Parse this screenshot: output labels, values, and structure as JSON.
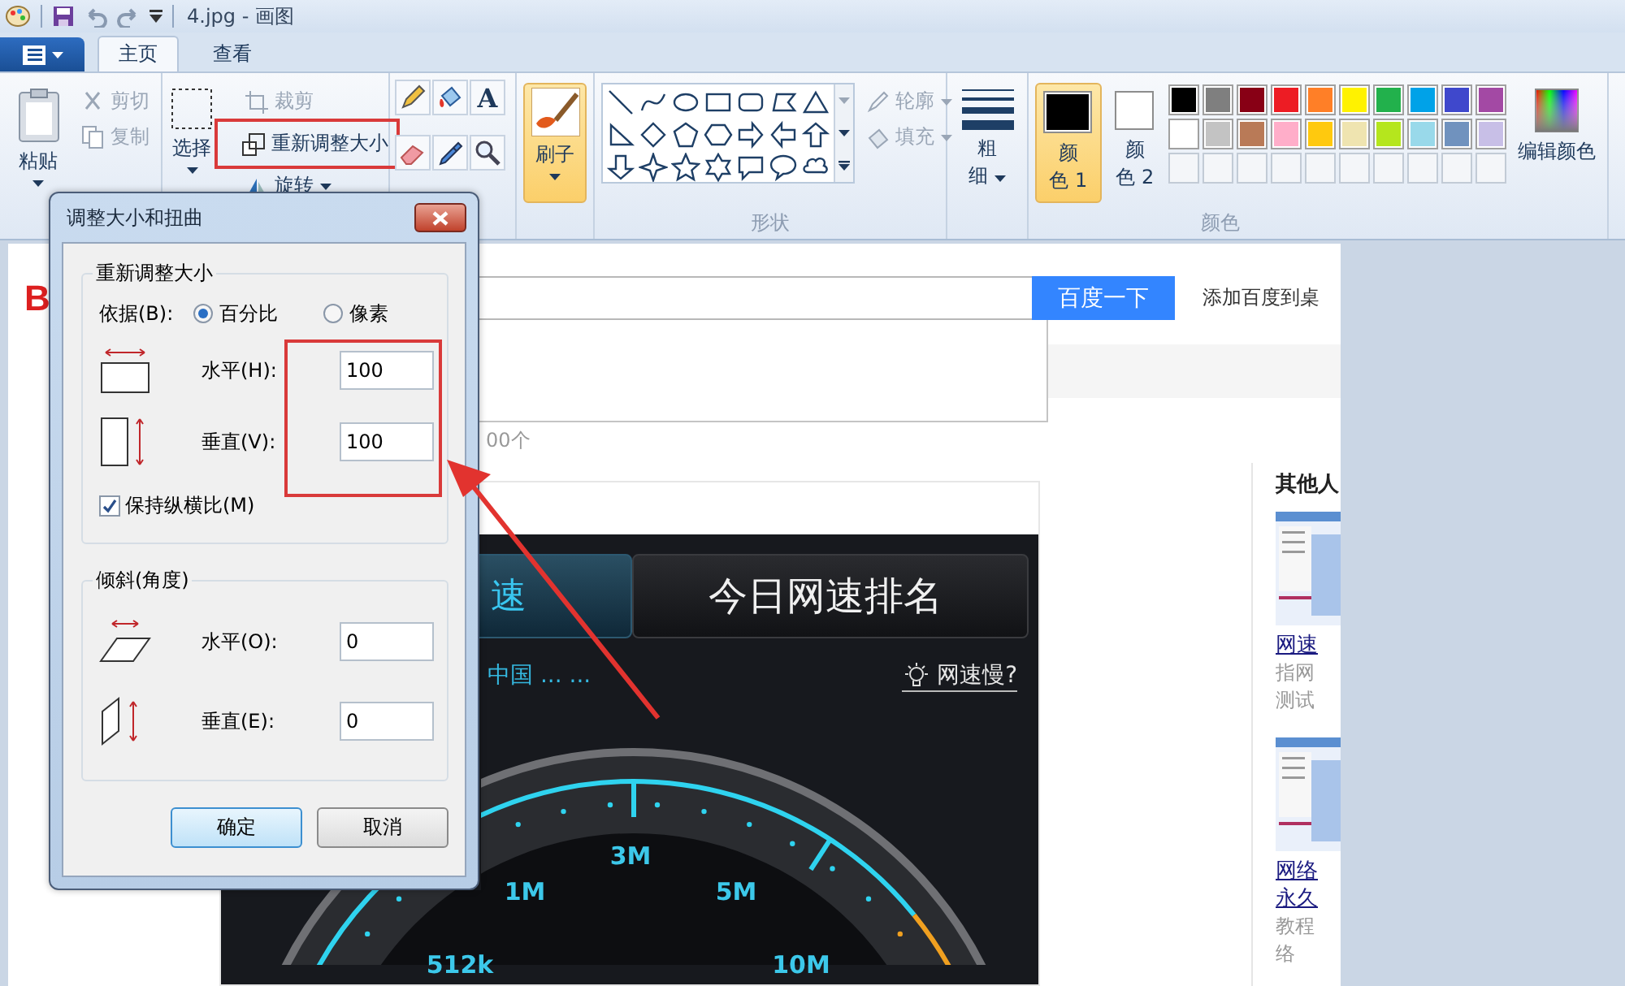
{
  "window": {
    "title": "4.jpg - 画图"
  },
  "tabs": [
    {
      "label": "主页",
      "selected": true
    },
    {
      "label": "查看",
      "selected": false
    }
  ],
  "ribbon": {
    "clipboard": {
      "paste": "粘贴",
      "cut": {
        "label": "剪切",
        "disabled": true
      },
      "copy": {
        "label": "复制",
        "disabled": true
      }
    },
    "image": {
      "select": "选择",
      "crop": {
        "label": "裁剪",
        "disabled": true
      },
      "resize": {
        "label": "重新调整大小",
        "disabled": false
      },
      "rotate": {
        "label": "旋转",
        "disabled": false
      }
    },
    "tools": {
      "text_tool": "A"
    },
    "brushes": {
      "label": "刷子",
      "selected": true
    },
    "shapes": {
      "label": "形状",
      "outline": {
        "label": "轮廓",
        "disabled": true
      },
      "fill": {
        "label": "填充",
        "disabled": true
      }
    },
    "size": {
      "label_lines": [
        "粗",
        "细"
      ]
    },
    "colors": {
      "label": "颜色",
      "edit": "编辑颜色",
      "color1": {
        "label_lines": [
          "颜",
          "色 1"
        ],
        "color": "#000000",
        "selected": true
      },
      "color2": {
        "label_lines": [
          "颜",
          "色 2"
        ],
        "color": "#ffffff",
        "selected": false
      },
      "palette": [
        {
          "color": "#000000"
        },
        {
          "color": "#7f7f7f"
        },
        {
          "color": "#880015"
        },
        {
          "color": "#ed1c24"
        },
        {
          "color": "#ff7f27"
        },
        {
          "color": "#fff200"
        },
        {
          "color": "#22b14c"
        },
        {
          "color": "#00a2e8"
        },
        {
          "color": "#3f48cc"
        },
        {
          "color": "#a349a4"
        },
        {
          "color": "#ffffff"
        },
        {
          "color": "#c3c3c3"
        },
        {
          "color": "#b97a57"
        },
        {
          "color": "#ffaec9"
        },
        {
          "color": "#ffc90e"
        },
        {
          "color": "#efe4b0"
        },
        {
          "color": "#b5e61d"
        },
        {
          "color": "#99d9ea"
        },
        {
          "color": "#7092be"
        },
        {
          "color": "#c8bfe7"
        }
      ]
    }
  },
  "canvas_image": {
    "logo": "B",
    "search_button": "百度一下",
    "add_link": "添加百度到桌",
    "result_count": "00个",
    "speed_test": {
      "tabs": [
        {
          "label": "速",
          "selected": true
        },
        {
          "label": "今日网速排名",
          "selected": false
        }
      ],
      "location": "中国 ... ...",
      "help": "网速慢?",
      "gauge_labels": [
        "512k",
        "1M",
        "3M",
        "5M",
        "10M"
      ]
    },
    "sidebar": {
      "title": "其他人",
      "items": [
        {
          "title": "网速",
          "description": [
            "指网",
            "测试"
          ]
        },
        {
          "title": "网络",
          "subtitle": "永久",
          "description": [
            "教程",
            "络"
          ]
        }
      ]
    }
  },
  "dialog": {
    "title": "调整大小和扭曲",
    "resize": {
      "title": "重新调整大小",
      "by_label": "依据(B):",
      "units": [
        {
          "label": "百分比",
          "selected": true
        },
        {
          "label": "像素",
          "selected": false
        }
      ],
      "fields": [
        {
          "label": "水平(H):",
          "value": "100"
        },
        {
          "label": "垂直(V):",
          "value": "100"
        }
      ],
      "keep_ratio": {
        "label": "保持纵横比(M)",
        "checked": true
      }
    },
    "skew": {
      "title": "倾斜(角度)",
      "fields": [
        {
          "label": "水平(O):",
          "value": "0"
        },
        {
          "label": "垂直(E):",
          "value": "0"
        }
      ]
    },
    "buttons": [
      {
        "label": "确定",
        "default": true
      },
      {
        "label": "取消",
        "default": false
      }
    ]
  }
}
